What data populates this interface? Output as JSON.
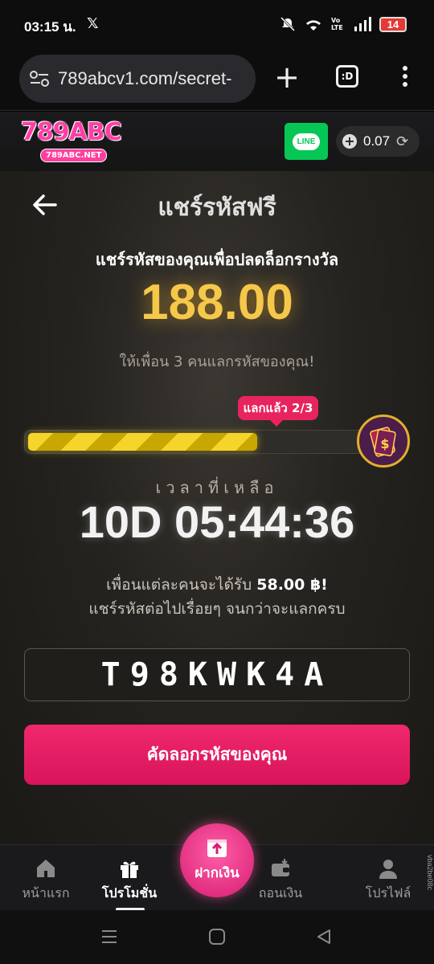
{
  "status_bar": {
    "time": "03:15 น.",
    "x_icon": "x-logo-icon",
    "battery": "14",
    "volte": "Vo LTE"
  },
  "browser": {
    "url": "789abcv1.com/secret-",
    "tabs_label": ":D"
  },
  "site_header": {
    "logo_main": "789ABC",
    "logo_sub": "789ABC.NET",
    "line_label": "LINE",
    "balance": "0.07"
  },
  "main": {
    "title": "แชร์รหัสฟรี",
    "subtitle": "แชร์รหัสของคุณเพื่อปลดล็อกรางวัล",
    "amount": "188.00",
    "invite_text": "ให้เพื่อน 3 คนแลกรหัสของคุณ!",
    "redeem_badge": "แลกแล้ว 2/3",
    "progress_fraction": 0.6667,
    "time_label": "เวลาที่เหลือ",
    "timer": "10D 05:44:36",
    "info_prefix": "เพื่อนแต่ละคนจะได้รับ",
    "info_amount": "58.00 ฿!",
    "info_line2": "แชร์รหัสต่อไปเรื่อยๆ จนกว่าจะแลกครบ",
    "code": "T98KWK4A",
    "copy_button": "คัดลอกรหัสของคุณ"
  },
  "bottom_nav": {
    "home": "หน้าแรก",
    "promotions": "โปรโมชั่น",
    "deposit": "ฝากเงิน",
    "withdraw": "ถอนเงิน",
    "profile": "โปรไฟล์",
    "active": "promotions"
  },
  "side_tag": "vba2be08c",
  "colors": {
    "accent_pink": "#e8245f",
    "gold": "#f6c84a",
    "line_green": "#06c755"
  }
}
